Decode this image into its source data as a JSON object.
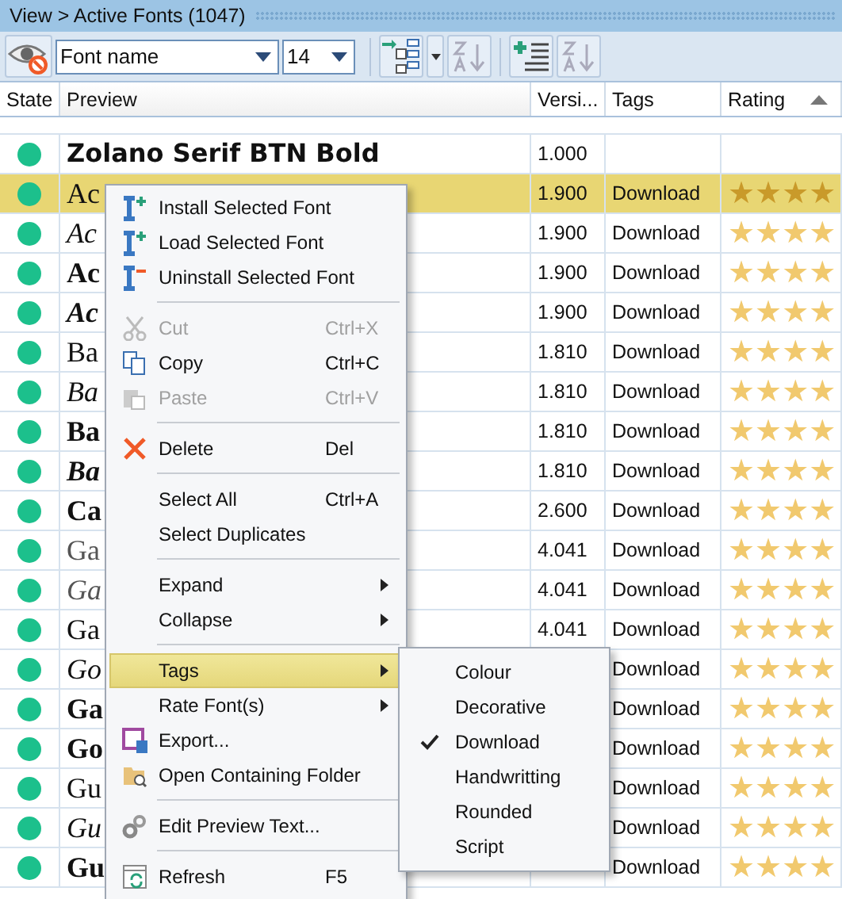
{
  "breadcrumb": "View > Active Fonts (1047)",
  "toolbar": {
    "font_field": "Font name",
    "size_field": "14"
  },
  "columns": [
    "State",
    "Preview",
    "Versi...",
    "Tags",
    "Rating"
  ],
  "rows": [
    {
      "preview": "Zolano Serif BTN Bold",
      "kind": "slab",
      "version": "1.000",
      "selected": false
    },
    {
      "preview": "Ac",
      "kind": "regular",
      "version": "1.900",
      "tags": "Download",
      "selected": true,
      "stars": 4
    },
    {
      "preview": "Ac",
      "kind": "italic",
      "version": "1.900",
      "tags": "Download",
      "selected": false,
      "stars": 4
    },
    {
      "preview": "Ac",
      "kind": "bold",
      "version": "1.900",
      "tags": "Download",
      "selected": false,
      "stars": 4
    },
    {
      "preview": "Ac",
      "kind": "bold-italic",
      "version": "1.900",
      "tags": "Download",
      "selected": false,
      "stars": 4
    },
    {
      "preview": "Ba",
      "kind": "regular",
      "version": "1.810",
      "tags": "Download",
      "selected": false,
      "stars": 4
    },
    {
      "preview": "Ba",
      "kind": "italic",
      "version": "1.810",
      "tags": "Download",
      "selected": false,
      "stars": 4
    },
    {
      "preview": "Ba",
      "kind": "bold",
      "version": "1.810",
      "tags": "Download",
      "selected": false,
      "stars": 4
    },
    {
      "preview": "Ba",
      "kind": "bold-italic",
      "version": "1.810",
      "tags": "Download",
      "selected": false,
      "stars": 4
    },
    {
      "preview": "Ca",
      "kind": "bold",
      "version": "2.600",
      "tags": "Download",
      "selected": false,
      "stars": 4
    },
    {
      "preview": "Ga",
      "kind": "light",
      "version": "4.041",
      "tags": "Download",
      "selected": false,
      "stars": 4
    },
    {
      "preview": "Ga",
      "kind": "light-italic",
      "version": "4.041",
      "tags": "Download",
      "selected": false,
      "stars": 4
    },
    {
      "preview": "Ga",
      "kind": "regular",
      "version": "4.041",
      "tags": "Download",
      "selected": false,
      "stars": 4
    },
    {
      "preview": "Go",
      "kind": "italic",
      "tags": "Download",
      "selected": false,
      "stars": 4
    },
    {
      "preview": "Ga",
      "kind": "bold",
      "tags": "Download",
      "selected": false,
      "stars": 4
    },
    {
      "preview": "Go",
      "kind": "bold",
      "tags": "Download",
      "selected": false,
      "stars": 4
    },
    {
      "preview": "Gu",
      "kind": "regular",
      "tags": "Download",
      "selected": false,
      "stars": 4
    },
    {
      "preview": "Gu",
      "kind": "italic",
      "tags": "Download",
      "selected": false,
      "stars": 4
    },
    {
      "preview": "Gu",
      "kind": "bold",
      "tags": "Download",
      "selected": false,
      "stars": 4
    }
  ],
  "context_menu": [
    {
      "kind": "item",
      "label": "Install Selected Font",
      "disabled": false,
      "selected": false
    },
    {
      "kind": "item",
      "label": "Load Selected Font",
      "disabled": false,
      "selected": false
    },
    {
      "kind": "item",
      "label": "Uninstall Selected Font",
      "disabled": false,
      "selected": false
    },
    {
      "kind": "separator"
    },
    {
      "kind": "item",
      "label": "Cut",
      "shortcut": "Ctrl+X",
      "disabled": true,
      "selected": false
    },
    {
      "kind": "item",
      "label": "Copy",
      "shortcut": "Ctrl+C",
      "disabled": false,
      "selected": false
    },
    {
      "kind": "item",
      "label": "Paste",
      "shortcut": "Ctrl+V",
      "disabled": true,
      "selected": false
    },
    {
      "kind": "separator"
    },
    {
      "kind": "item",
      "label": "Delete",
      "shortcut": "Del",
      "disabled": false,
      "selected": false
    },
    {
      "kind": "separator"
    },
    {
      "kind": "item",
      "label": "Select All",
      "shortcut": "Ctrl+A",
      "disabled": false,
      "selected": false
    },
    {
      "kind": "item",
      "label": "Select Duplicates",
      "disabled": false,
      "selected": false
    },
    {
      "kind": "separator"
    },
    {
      "kind": "submenu",
      "label": "Expand",
      "disabled": false,
      "selected": false
    },
    {
      "kind": "submenu",
      "label": "Collapse",
      "disabled": false,
      "selected": false
    },
    {
      "kind": "separator"
    },
    {
      "kind": "submenu",
      "label": "Tags",
      "disabled": false,
      "selected": true
    },
    {
      "kind": "submenu",
      "label": "Rate Font(s)",
      "disabled": false,
      "selected": false
    },
    {
      "kind": "item",
      "label": "Export...",
      "disabled": false,
      "selected": false
    },
    {
      "kind": "item",
      "label": "Open Containing Folder",
      "disabled": false,
      "selected": false
    },
    {
      "kind": "separator"
    },
    {
      "kind": "item",
      "label": "Edit Preview Text...",
      "disabled": false,
      "selected": false
    },
    {
      "kind": "separator"
    },
    {
      "kind": "item",
      "label": "Refresh",
      "shortcut": "F5",
      "disabled": false,
      "selected": false
    }
  ],
  "tags_submenu": [
    {
      "label": "Colour",
      "checked": false
    },
    {
      "label": "Decorative",
      "checked": false
    },
    {
      "label": "Download",
      "checked": true
    },
    {
      "label": "Handwritting",
      "checked": false
    },
    {
      "label": "Rounded",
      "checked": false
    },
    {
      "label": "Script",
      "checked": false
    }
  ]
}
